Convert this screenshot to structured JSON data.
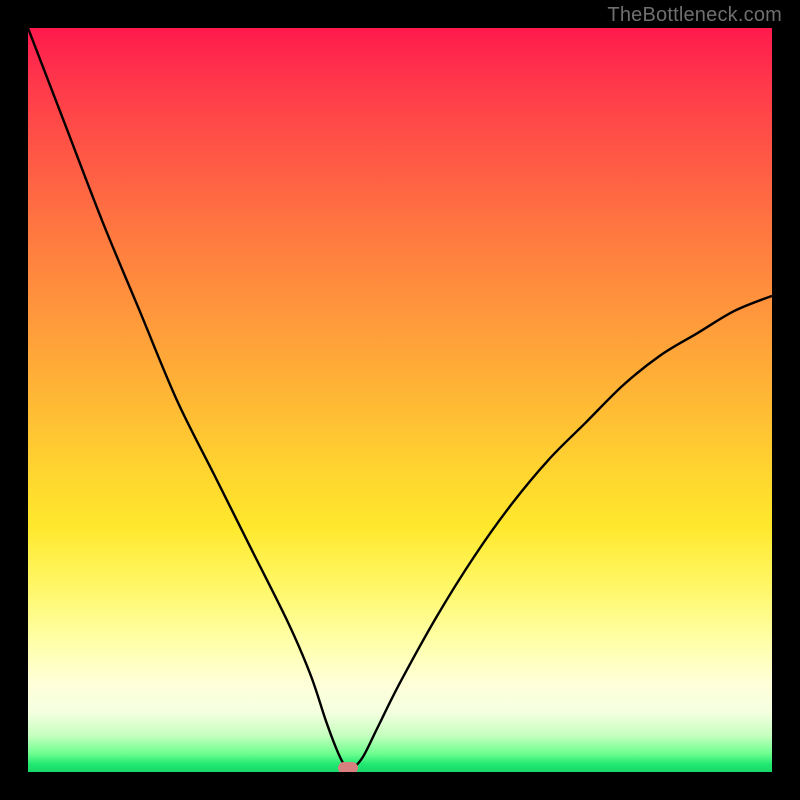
{
  "watermark": "TheBottleneck.com",
  "chart_data": {
    "type": "line",
    "title": "",
    "xlabel": "",
    "ylabel": "",
    "xlim": [
      0,
      100
    ],
    "ylim": [
      0,
      100
    ],
    "grid": false,
    "series": [
      {
        "name": "bottleneck-curve",
        "x": [
          0,
          5,
          10,
          15,
          20,
          25,
          30,
          35,
          38,
          40,
          41.5,
          42.5,
          43.5,
          45,
          47,
          50,
          55,
          60,
          65,
          70,
          75,
          80,
          85,
          90,
          95,
          100
        ],
        "values": [
          100,
          87,
          74,
          62,
          50,
          40,
          30,
          20,
          13,
          7,
          3,
          1,
          0.5,
          2,
          6,
          12,
          21,
          29,
          36,
          42,
          47,
          52,
          56,
          59,
          62,
          64
        ]
      }
    ],
    "marker": {
      "x": 43,
      "y": 0.5
    },
    "background_gradient": {
      "top": "#ff1a4d",
      "mid": "#ffd030",
      "bottom": "#19d868"
    }
  }
}
